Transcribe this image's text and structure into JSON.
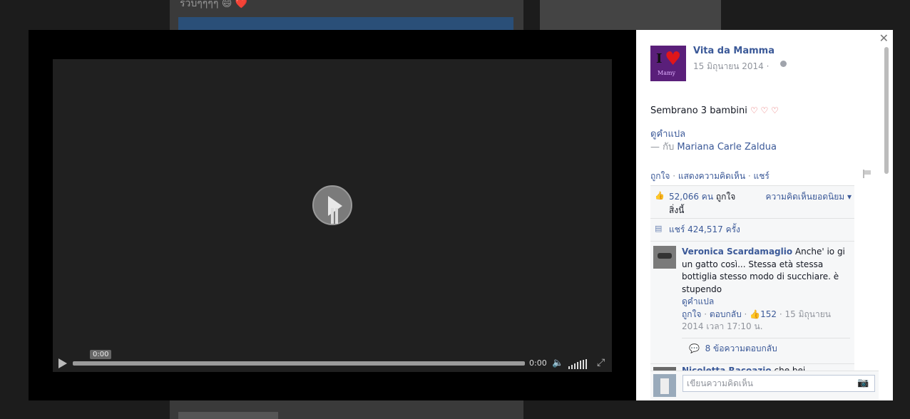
{
  "background": {
    "snippet": "รวบๆๆๆๆ 😄 ❤️"
  },
  "video": {
    "current_time_tip": "0:00",
    "duration": "0:00"
  },
  "post": {
    "page_name": "Vita da Mamma",
    "date": "15 มิถุนายน 2014 ·",
    "avatar_letter": "I",
    "avatar_text": "Mamy",
    "text": "Sembrano 3 bambini",
    "hearts": "♡ ♡ ♡",
    "translate": "ดูคำแปล",
    "with_prefix": "— กับ ",
    "with_name": "Mariana Carle Zaldua",
    "actions": {
      "like": "ถูกใจ",
      "sep": " · ",
      "comment": "แสดงความคิดเห็น",
      "share": "แชร์"
    },
    "likes": {
      "count": "52,066 คน",
      "suffix_line1": " ถูกใจ",
      "suffix_line2": "สิ่งนี้",
      "top_comments": "ความคิดเห็นยอดนิยม ▾"
    },
    "shares": "แชร์ 424,517 ครั้ง"
  },
  "comments": [
    {
      "name": "Veronica Scardamaglio",
      "text": "Anche' io gi un gatto così... Stessa età stessa bottiglia stesso modo di succhiare. è stupendo",
      "translate": "ดูคำแปล",
      "like": "ถูกใจ",
      "reply": "ตอบกลับ",
      "likes": "152",
      "timestamp": "15 มิถุนายน 2014 เวลา 17:10 น.",
      "replies": "8 ข้อความตอบกลับ"
    },
    {
      "name": "Nicoletta Racoazio",
      "text": "che bei"
    }
  ],
  "composer": {
    "placeholder": "เขียนความคิดเห็น"
  }
}
